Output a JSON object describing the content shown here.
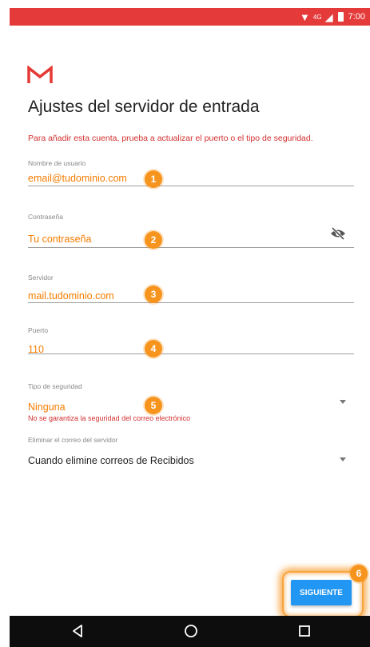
{
  "status_bar": {
    "time": "7:00",
    "network": "4G",
    "bg_color": "#e53a3a"
  },
  "app": {
    "logo_icon": "gmail-m-icon",
    "title": "Ajustes del servidor de entrada",
    "warning": "Para añadir esta cuenta, prueba a actualizar el puerto o el tipo de seguridad."
  },
  "form": {
    "username": {
      "label": "Nombre de usuario",
      "value": "email@tudominio.com"
    },
    "password": {
      "label": "Contraseña",
      "value": "Tu contraseña",
      "toggle_icon": "visibility-off-icon"
    },
    "server": {
      "label": "Servidor",
      "value": "mail.tudominio.com"
    },
    "port": {
      "label": "Puerto",
      "value": "110"
    },
    "security": {
      "label": "Tipo de seguridad",
      "value": "Ninguna",
      "hint": "No se garantiza la seguridad del correo electrónico"
    },
    "delete": {
      "label": "Eliminar el correo del servidor",
      "value": "Cuando elimine correos de Recibidos"
    }
  },
  "markers": [
    "1",
    "2",
    "3",
    "4",
    "5",
    "6"
  ],
  "actions": {
    "next_label": "SIGUIENTE"
  },
  "nav": {
    "back_icon": "back-triangle-icon",
    "home_icon": "home-circle-icon",
    "recents_icon": "recents-square-icon"
  },
  "colors": {
    "accent": "#f57c00",
    "error": "#d32f2f",
    "button": "#2196f3",
    "marker": "#f7941d"
  }
}
